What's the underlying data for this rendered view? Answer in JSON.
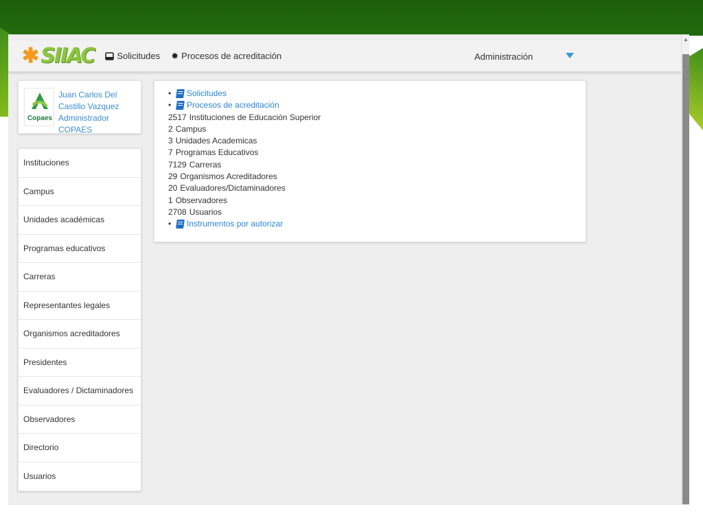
{
  "navbar": {
    "logo_text": "SIIAC",
    "solicitudes_label": "Solicitudes",
    "procesos_label": "Procesos de acreditación",
    "admin_label": "Administración"
  },
  "user": {
    "name": "Juan Carlos Del Castillo Vazquez Administrador COPAES",
    "logo_word": "Copaes"
  },
  "sidebar": {
    "items": [
      {
        "label": "Instituciones"
      },
      {
        "label": "Campus"
      },
      {
        "label": "Unidades académicas"
      },
      {
        "label": "Programas educativos"
      },
      {
        "label": "Carreras"
      },
      {
        "label": "Representantes legales"
      },
      {
        "label": "Organismos acreditadores"
      },
      {
        "label": "Presidentes"
      },
      {
        "label": "Evaluadores / Dictaminadores"
      },
      {
        "label": "Observadores"
      },
      {
        "label": "Directorio"
      },
      {
        "label": "Usuarios"
      }
    ]
  },
  "main": {
    "link_solicitudes": "Solicitudes",
    "link_procesos": "Procesos de acreditación",
    "stats": [
      {
        "count": "2517",
        "label": "Instituciones de Educación Superior"
      },
      {
        "count": "2",
        "label": "Campus"
      },
      {
        "count": "3",
        "label": "Unidades Academicas"
      },
      {
        "count": "7",
        "label": "Programas Educativos"
      },
      {
        "count": "7129",
        "label": "Carreras"
      },
      {
        "count": "29",
        "label": "Organismos Acreditadores"
      },
      {
        "count": "20",
        "label": "Evaluadores/Dictaminadores"
      },
      {
        "count": "1",
        "label": "Observadores"
      },
      {
        "count": "2708",
        "label": "Usuarios"
      }
    ],
    "link_instrumentos": "Instrumentos por autorizar"
  },
  "colors": {
    "link": "#2b86d6",
    "brand_green": "#8cc63f",
    "accent_orange": "#f29a1e",
    "header_green": "#1d5e0a"
  }
}
